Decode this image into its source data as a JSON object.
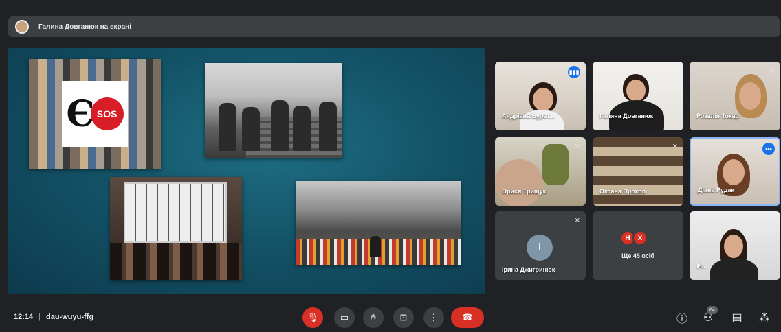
{
  "presenter": {
    "text": "Галина Довганюк на екрані"
  },
  "participants": [
    {
      "name": "Андріана Бурет...",
      "status": "speaking"
    },
    {
      "name": "Галина Довганюк",
      "status": ""
    },
    {
      "name": "Розалія Токар",
      "status": "muted"
    },
    {
      "name": "Орися Трищук",
      "status": "muted"
    },
    {
      "name": "Оксана Прокоп",
      "status": "muted"
    },
    {
      "name": "Діана Рудак",
      "status": "more"
    },
    {
      "name": "Ірина Джигринюк",
      "initial": "І",
      "status": "muted"
    },
    {
      "name": "Ін...",
      "status": "muted"
    }
  ],
  "others": {
    "initials": [
      "Н",
      "Х"
    ],
    "label": "Ще 45 осіб"
  },
  "meeting": {
    "time": "12:14",
    "code": "dau-wuyu-ffg"
  },
  "people_count": "64",
  "icons": {
    "mic_off": "mic-off-icon",
    "camera": "camera-icon",
    "raise_hand": "hand-icon",
    "present": "present-icon",
    "more": "more-vert-icon",
    "end_call": "call-end-icon",
    "info": "info-icon",
    "people": "people-icon",
    "chat": "chat-icon",
    "activities": "activities-icon"
  },
  "colors": {
    "end_call": "#d93025",
    "accent": "#1a73e8",
    "bar": "#202124"
  }
}
